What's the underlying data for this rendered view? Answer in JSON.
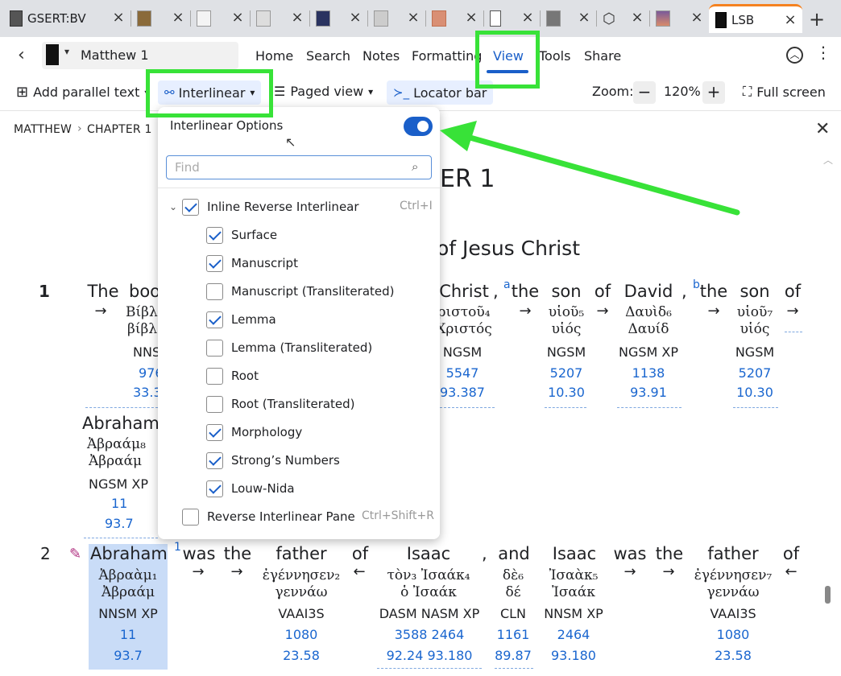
{
  "tabs": [
    {
      "label": "GSERT:BV"
    },
    {
      "label": ""
    },
    {
      "label": ""
    },
    {
      "label": ""
    },
    {
      "label": ""
    },
    {
      "label": ""
    },
    {
      "label": ""
    },
    {
      "label": ""
    },
    {
      "label": ""
    },
    {
      "label": ""
    },
    {
      "label": ""
    },
    {
      "label": "LSB"
    }
  ],
  "appbar": {
    "resource_title": "Matthew 1",
    "menu": [
      "Home",
      "Search",
      "Notes",
      "Formatting",
      "View",
      "Tools",
      "Share"
    ]
  },
  "toolbar": {
    "add_parallel": "Add parallel text",
    "interlinear": "Interlinear",
    "paged_view": "Paged view",
    "locator_bar": "Locator bar",
    "zoom_label": "Zoom:",
    "zoom_value": "120%",
    "full_screen": "Full screen"
  },
  "breadcrumb": {
    "book": "MATTHEW",
    "chapter": "CHAPTER 1"
  },
  "dropdown": {
    "title": "Interlinear Options",
    "toggle_on": true,
    "find_placeholder": "Find",
    "group_label": "Inline Reverse Interlinear",
    "group_shortcut": "Ctrl+I",
    "options": [
      {
        "label": "Surface",
        "checked": true
      },
      {
        "label": "Manuscript",
        "checked": true
      },
      {
        "label": "Manuscript (Transliterated)",
        "checked": false
      },
      {
        "label": "Lemma",
        "checked": true
      },
      {
        "label": "Lemma (Transliterated)",
        "checked": false
      },
      {
        "label": "Root",
        "checked": false
      },
      {
        "label": "Root (Transliterated)",
        "checked": false
      },
      {
        "label": "Morphology",
        "checked": true
      },
      {
        "label": "Strong’s Numbers",
        "checked": true
      },
      {
        "label": "Louw-Nida",
        "checked": true
      }
    ],
    "pane_label": "Reverse Interlinear Pane",
    "pane_shortcut": "Ctrl+Shift+R"
  },
  "content": {
    "chapter_heading_visible": "ER 1",
    "subtitle_visible": "of Jesus Christ",
    "verse1": {
      "number": "1",
      "words": [
        {
          "en": "The",
          "gk1": "",
          "gk2": "",
          "mo": "",
          "n1": "",
          "n2": ""
        },
        {
          "en": "boo",
          "gk1": "Βίβλο",
          "gk2": "βίβλ",
          "mo": "NNS",
          "n1": "976",
          "n2": "33.3"
        },
        {
          "en": "Christ",
          "gk1": "ριστοῦ₄",
          "gk2": "Χριστός",
          "mo": "NGSM",
          "n1": "5547",
          "n2": "93.387"
        },
        {
          "en": "the",
          "gk1": "",
          "gk2": "",
          "mo": "",
          "n1": "",
          "n2": ""
        },
        {
          "en": "son",
          "gk1": "υἱοῦ₅",
          "gk2": "υἱός",
          "mo": "NGSM",
          "n1": "5207",
          "n2": "10.30"
        },
        {
          "en": "of",
          "gk1": "",
          "gk2": "",
          "mo": "",
          "n1": "",
          "n2": ""
        },
        {
          "en": "David",
          "gk1": "Δαυὶδ₆",
          "gk2": "Δαυίδ",
          "mo": "NGSM XP",
          "n1": "1138",
          "n2": "93.91"
        },
        {
          "en": "the",
          "gk1": "",
          "gk2": "",
          "mo": "",
          "n1": "",
          "n2": ""
        },
        {
          "en": "son",
          "gk1": "υἱοῦ₇",
          "gk2": "υἱός",
          "mo": "NGSM",
          "n1": "5207",
          "n2": "10.30"
        },
        {
          "en": "of",
          "gk1": "",
          "gk2": "",
          "mo": "",
          "n1": "",
          "n2": ""
        },
        {
          "en": "Abraham",
          "gk1": "Ἀβραάμ₈",
          "gk2": "Ἀβραάμ",
          "mo": "NGSM XP",
          "n1": "11",
          "n2": "93.7"
        }
      ],
      "footnote_a": "a",
      "footnote_b": "b"
    },
    "verse2": {
      "number": "2",
      "footnote_1": "1",
      "words": [
        {
          "en": "Abraham",
          "gk1": "Ἀβραὰμ₁",
          "gk2": "Ἀβραάμ",
          "mo": "NNSM XP",
          "n1": "11",
          "n2": "93.7"
        },
        {
          "en": "was",
          "gk1": "",
          "gk2": "",
          "mo": "",
          "n1": "",
          "n2": ""
        },
        {
          "en": "the",
          "gk1": "",
          "gk2": "",
          "mo": "",
          "n1": "",
          "n2": ""
        },
        {
          "en": "father",
          "gk1": "ἐγέννησεν₂",
          "gk2": "γεννάω",
          "mo": "VAAI3S",
          "n1": "1080",
          "n2": "23.58"
        },
        {
          "en": "of",
          "gk1": "",
          "gk2": "",
          "mo": "",
          "n1": "",
          "n2": ""
        },
        {
          "en": "Isaac",
          "gk1": "τὸν₃ Ἰσαάκ₄",
          "gk2": "ὁ Ἰσαάκ",
          "mo": "DASM NASM XP",
          "n1": "3588 2464",
          "n2": "92.24 93.180"
        },
        {
          "en": ",",
          "gk1": "",
          "gk2": "",
          "mo": "",
          "n1": "",
          "n2": ""
        },
        {
          "en": "and",
          "gk1": "δὲ₆",
          "gk2": "δέ",
          "mo": "CLN",
          "n1": "1161",
          "n2": "89.87"
        },
        {
          "en": "Isaac",
          "gk1": "Ἰσαὰκ₅",
          "gk2": "Ἰσαάκ",
          "mo": "NNSM XP",
          "n1": "2464",
          "n2": "93.180"
        },
        {
          "en": "was",
          "gk1": "",
          "gk2": "",
          "mo": "",
          "n1": "",
          "n2": ""
        },
        {
          "en": "the",
          "gk1": "",
          "gk2": "",
          "mo": "",
          "n1": "",
          "n2": ""
        },
        {
          "en": "father",
          "gk1": "ἐγέννησεν₇",
          "gk2": "γεννάω",
          "mo": "VAAI3S",
          "n1": "1080",
          "n2": "23.58"
        },
        {
          "en": "of",
          "gk1": "",
          "gk2": "",
          "mo": "",
          "n1": "",
          "n2": ""
        }
      ]
    }
  },
  "colors": {
    "highlight_green": "#38e238",
    "accent_blue": "#1a5fc9",
    "number_blue": "#1a66cf",
    "selection": "#c9dcf7"
  }
}
